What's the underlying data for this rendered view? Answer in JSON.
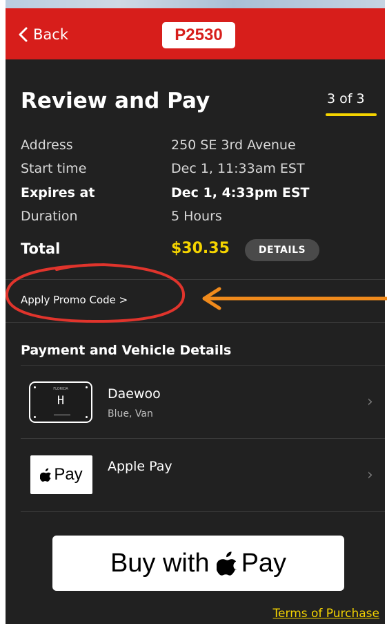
{
  "status_bar": {},
  "header": {
    "back_label": "Back",
    "plate_number": "P2530",
    "bg_color": "#d71e1b"
  },
  "review": {
    "title": "Review and Pay",
    "step": "3 of 3",
    "rows": [
      {
        "label": "Address",
        "value": "250 SE 3rd Avenue",
        "bold": false
      },
      {
        "label": "Start time",
        "value": "Dec 1, 11:33am EST",
        "bold": false
      },
      {
        "label": "Expires at",
        "value": "Dec 1, 4:33pm EST",
        "bold": true
      },
      {
        "label": "Duration",
        "value": "5 Hours",
        "bold": false
      }
    ],
    "total_label": "Total",
    "total_value": "$30.35",
    "details_label": "DETAILS"
  },
  "promo": {
    "label": "Apply Promo Code >"
  },
  "payment_section": {
    "title": "Payment and Vehicle Details",
    "vehicle": {
      "plate_state": "FLORIDA",
      "plate_char": "H",
      "name": "Daewoo",
      "description": "Blue, Van"
    },
    "payment_method": {
      "icon_text": "Pay",
      "name": "Apple Pay"
    }
  },
  "buy_button": {
    "label_prefix": "Buy with",
    "label_suffix": "Pay"
  },
  "terms_link": "Terms of Purchase",
  "colors": {
    "background": "#212121",
    "accent_yellow": "#f5d400",
    "annotation_red": "#e0342c",
    "annotation_orange": "#f08a1c"
  }
}
